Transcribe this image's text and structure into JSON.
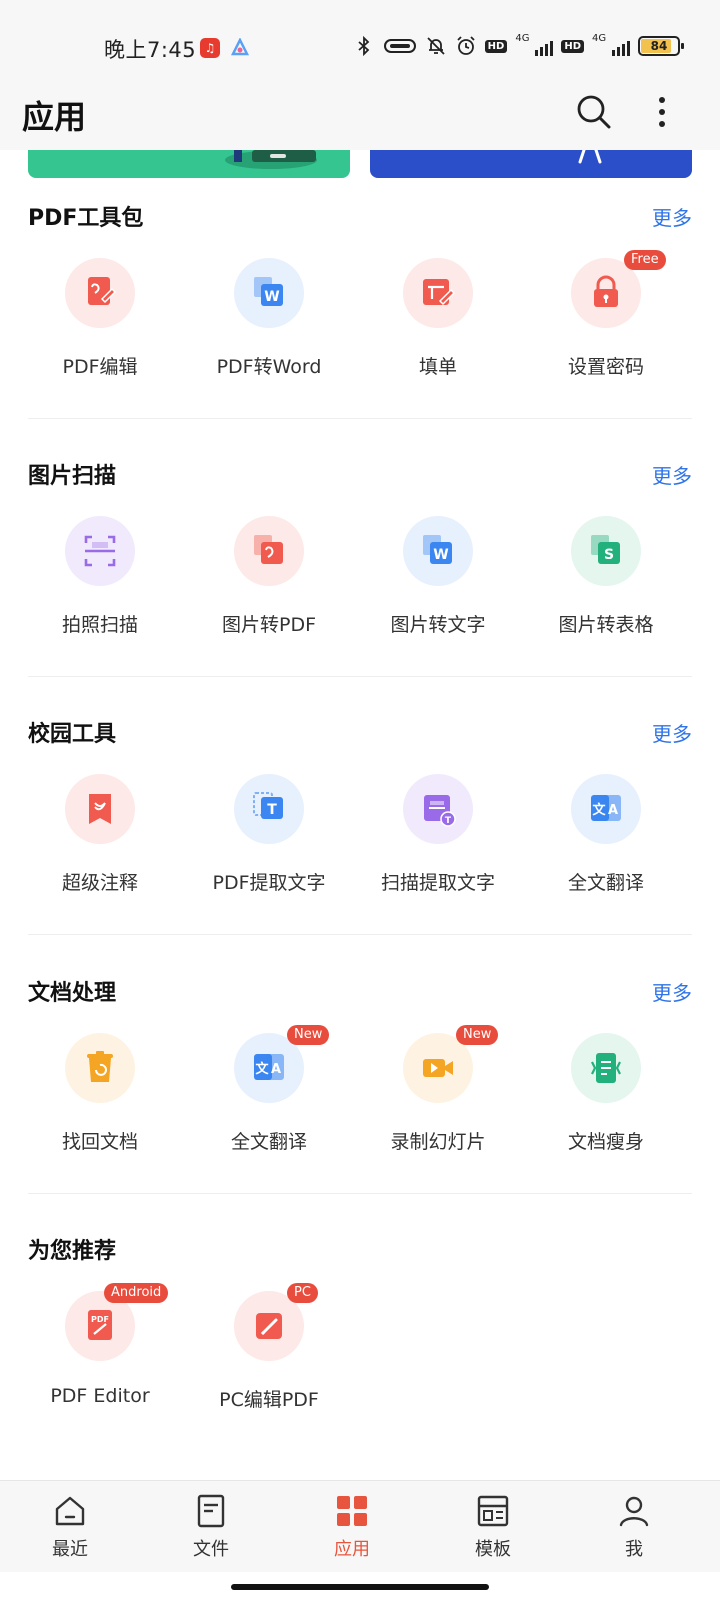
{
  "status_bar": {
    "time": "晚上7:45",
    "battery": "84",
    "network_1": "4G",
    "network_2": "4G",
    "hd_1": "HD",
    "hd_2": "HD"
  },
  "header": {
    "title": "应用"
  },
  "sections": [
    {
      "title": "PDF工具包",
      "more": "更多",
      "tools": [
        {
          "label": "PDF编辑",
          "icon": "pdf-edit-icon",
          "color": "#f05a4f",
          "bg": "#fde9e7"
        },
        {
          "label": "PDF转Word",
          "icon": "pdf-to-word-icon",
          "color": "#3b86f0",
          "bg": "#e7f0fd"
        },
        {
          "label": "填单",
          "icon": "fill-form-icon",
          "color": "#f05a4f",
          "bg": "#fde9e7"
        },
        {
          "label": "设置密码",
          "icon": "lock-icon",
          "color": "#f05a4f",
          "bg": "#fde9e7",
          "badge": "Free"
        }
      ]
    },
    {
      "title": "图片扫描",
      "more": "更多",
      "tools": [
        {
          "label": "拍照扫描",
          "icon": "scan-icon",
          "color": "#9a6be8",
          "bg": "#f1eafc"
        },
        {
          "label": "图片转PDF",
          "icon": "image-to-pdf-icon",
          "color": "#f05a4f",
          "bg": "#fde9e7"
        },
        {
          "label": "图片转文字",
          "icon": "image-to-word-icon",
          "color": "#3b86f0",
          "bg": "#e7f0fd"
        },
        {
          "label": "图片转表格",
          "icon": "image-to-sheet-icon",
          "color": "#22b07d",
          "bg": "#e4f6ee"
        }
      ]
    },
    {
      "title": "校园工具",
      "more": "更多",
      "tools": [
        {
          "label": "超级注释",
          "icon": "annotate-icon",
          "color": "#f05a4f",
          "bg": "#fde9e7"
        },
        {
          "label": "PDF提取文字",
          "icon": "extract-text-icon",
          "color": "#3b86f0",
          "bg": "#e7f0fd"
        },
        {
          "label": "扫描提取文字",
          "icon": "scan-text-icon",
          "color": "#9a6be8",
          "bg": "#f1eafc"
        },
        {
          "label": "全文翻译",
          "icon": "translate-icon",
          "color": "#3b86f0",
          "bg": "#e7f0fd"
        }
      ]
    },
    {
      "title": "文档处理",
      "more": "更多",
      "tools": [
        {
          "label": "找回文档",
          "icon": "recover-doc-icon",
          "color": "#f5a524",
          "bg": "#fef3e2"
        },
        {
          "label": "全文翻译",
          "icon": "translate-icon",
          "color": "#3b86f0",
          "bg": "#e7f0fd",
          "badge": "New"
        },
        {
          "label": "录制幻灯片",
          "icon": "record-video-icon",
          "color": "#f5a524",
          "bg": "#fef3e2",
          "badge": "New"
        },
        {
          "label": "文档瘦身",
          "icon": "slim-doc-icon",
          "color": "#22b07d",
          "bg": "#e4f6ee"
        }
      ]
    },
    {
      "title": "为您推荐",
      "tools": [
        {
          "label": "PDF Editor",
          "icon": "pdf-editor-icon",
          "color": "#f05a4f",
          "bg": "#fde9e7",
          "badge": "Android"
        },
        {
          "label": "PC编辑PDF",
          "icon": "pc-edit-pdf-icon",
          "color": "#f05a4f",
          "bg": "#fde9e7",
          "badge": "PC"
        }
      ]
    }
  ],
  "bottom_nav": [
    {
      "label": "最近",
      "icon": "home-icon"
    },
    {
      "label": "文件",
      "icon": "file-icon"
    },
    {
      "label": "应用",
      "icon": "apps-icon",
      "active": true
    },
    {
      "label": "模板",
      "icon": "template-icon"
    },
    {
      "label": "我",
      "icon": "profile-icon"
    }
  ],
  "accent_color": "#e8553f",
  "link_color": "#2f74e8"
}
